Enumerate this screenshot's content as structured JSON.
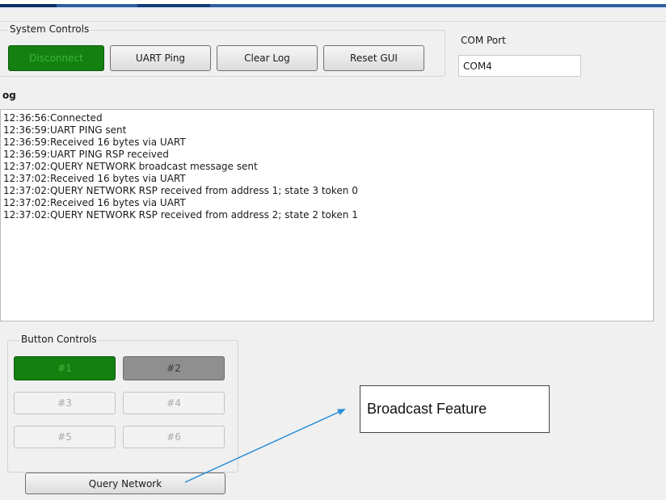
{
  "system_controls": {
    "group_title": "System Controls",
    "disconnect_label": "Disconnect",
    "uart_ping_label": "UART Ping",
    "clear_log_label": "Clear Log",
    "reset_gui_label": "Reset GUI"
  },
  "com_port": {
    "label": "COM Port",
    "value": "COM4"
  },
  "log": {
    "heading": "og",
    "lines": [
      "12:36:56:Connected",
      "12:36:59:UART PING sent",
      "12:36:59:Received 16 bytes via UART",
      "12:36:59:UART PING RSP received",
      "12:37:02:QUERY NETWORK broadcast message sent",
      "12:37:02:Received 16 bytes via UART",
      "12:37:02:QUERY NETWORK RSP received from address 1; state 3 token 0",
      "12:37:02:Received 16 bytes via UART",
      "12:37:02:QUERY NETWORK RSP received from address 2; state 2 token 1"
    ]
  },
  "button_controls": {
    "group_title": "Button Controls",
    "buttons": [
      {
        "label": "#1",
        "state": "active-green"
      },
      {
        "label": "#2",
        "state": "active-gray"
      },
      {
        "label": "#3",
        "state": "disabled"
      },
      {
        "label": "#4",
        "state": "disabled"
      },
      {
        "label": "#5",
        "state": "disabled"
      },
      {
        "label": "#6",
        "state": "disabled"
      }
    ],
    "query_network_label": "Query Network"
  },
  "annotation": {
    "callout_text": "Broadcast Feature",
    "arrow_color": "#2a8fd6"
  },
  "colors": {
    "green_button": "#13800f",
    "gray_button": "#8f8f8f"
  }
}
